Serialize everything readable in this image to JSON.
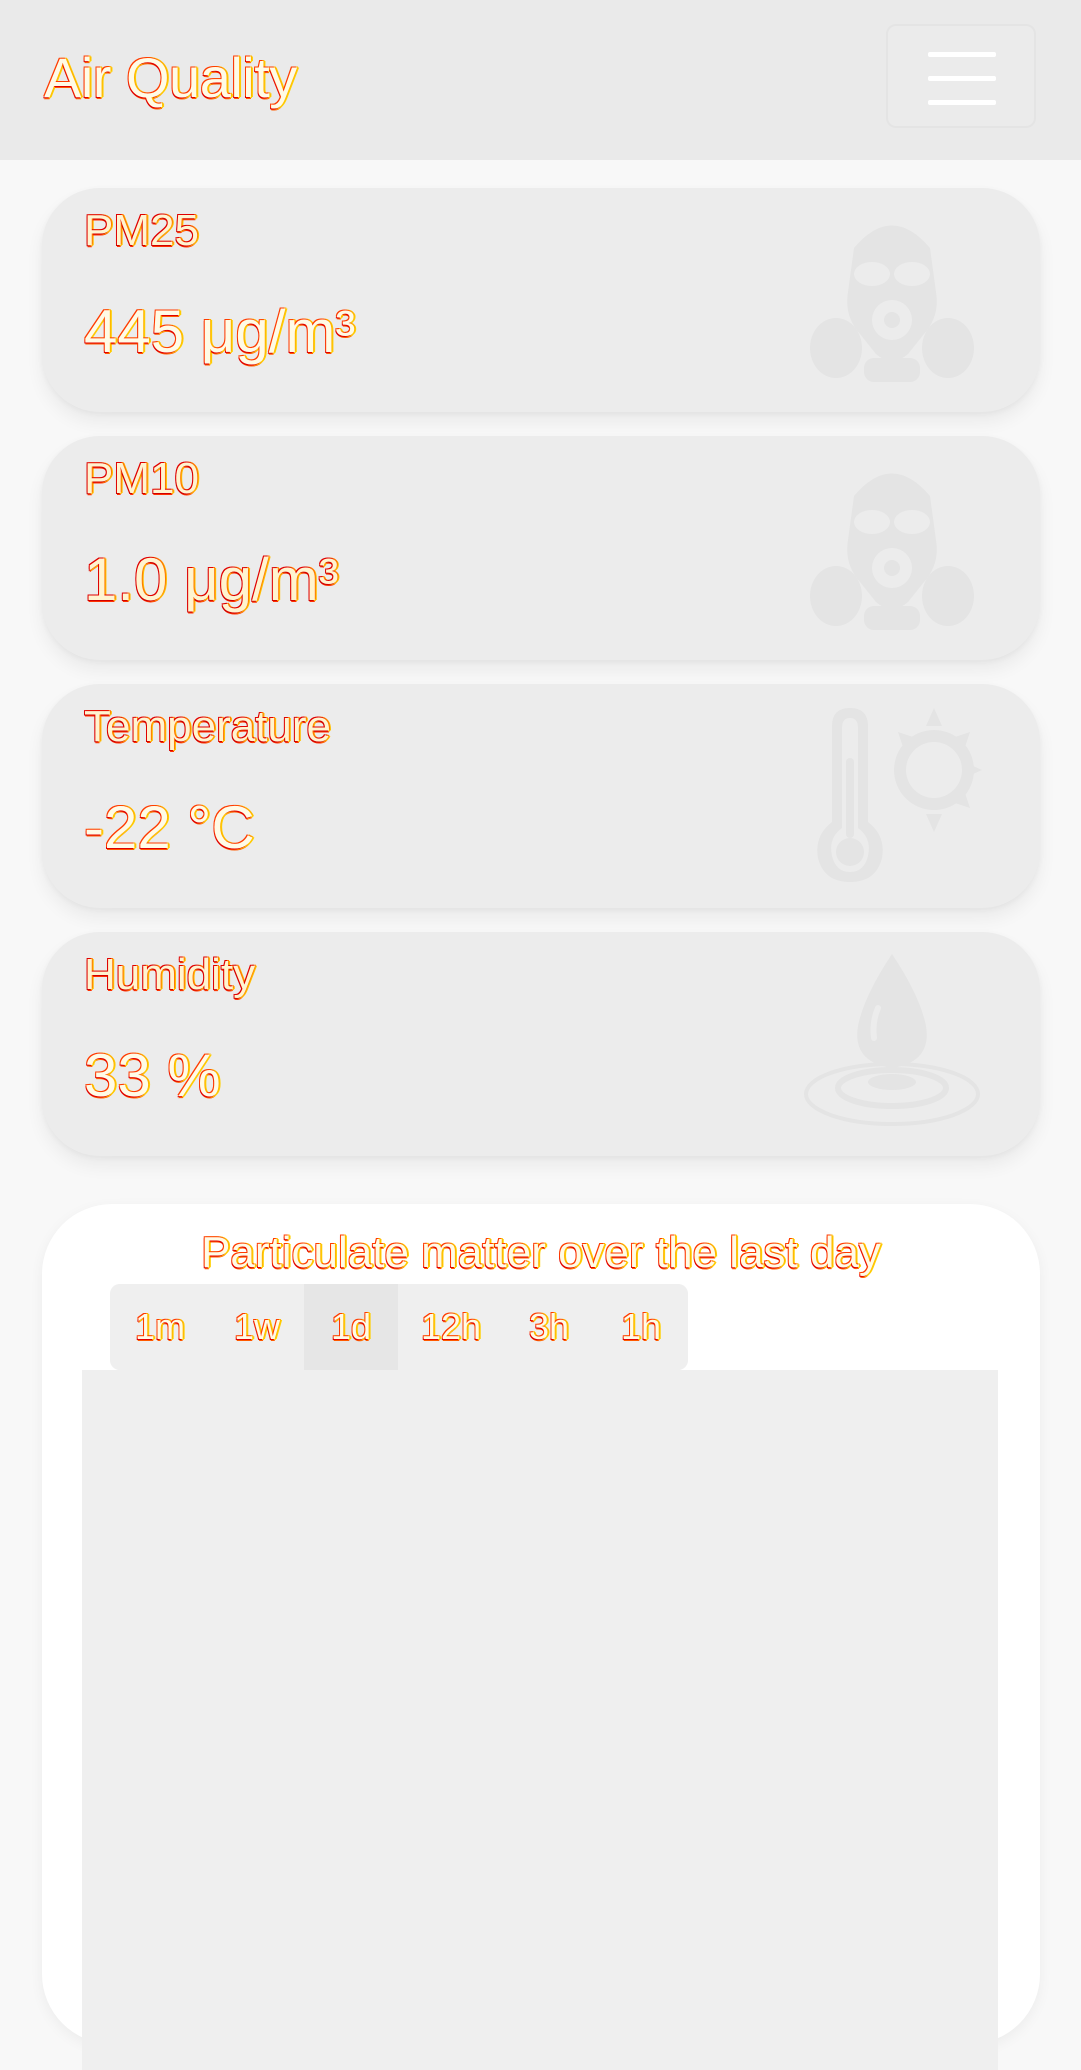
{
  "navbar": {
    "brand": "Air Quality",
    "menu_icon": "hamburger-menu-icon"
  },
  "cards": [
    {
      "label": "PM25",
      "value": "445 μg/m³",
      "icon": "gas-mask-icon"
    },
    {
      "label": "PM10",
      "value": "1.0 μg/m³",
      "icon": "gas-mask-icon"
    },
    {
      "label": "Temperature",
      "value": "-22 °C",
      "icon": "thermometer-sun-icon"
    },
    {
      "label": "Humidity",
      "value": "33 %",
      "icon": "water-drop-icon"
    }
  ],
  "chart": {
    "title": "Particulate matter over the last day",
    "ranges": [
      "1m",
      "1w",
      "1d",
      "12h",
      "3h",
      "1h"
    ],
    "selected_range": "1d"
  },
  "colors": {
    "navbar_bg": "#eaeaea",
    "card_bg": "#ececec",
    "page_bg": "#f8f8f8",
    "text_outline": "#ff3b00"
  }
}
